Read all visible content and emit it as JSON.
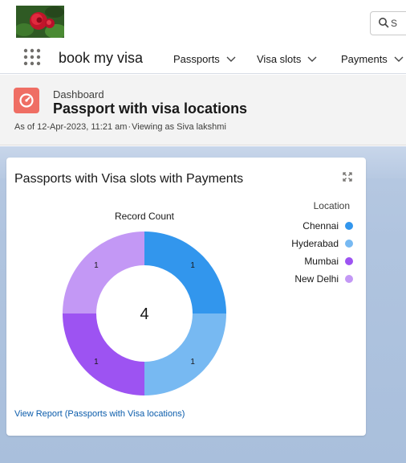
{
  "search": {
    "text": "S"
  },
  "nav": {
    "app_name": "book my visa",
    "items": [
      {
        "label": "Passports"
      },
      {
        "label": "Visa slots"
      },
      {
        "label": "Payments"
      }
    ]
  },
  "header": {
    "kicker": "Dashboard",
    "title": "Passport with visa locations",
    "as_of": "As of 12-Apr-2023, 11:21 am",
    "separator": "·",
    "viewing": "Viewing as Siva lakshmi"
  },
  "card": {
    "title": "Passports with Visa slots with Payments",
    "view_report": "View Report (Passports with Visa locations)"
  },
  "colors": {
    "brand_icon": "#ef6e64",
    "link": "#0b5cab"
  },
  "chart_data": {
    "type": "donut",
    "title": "Record Count",
    "center_label": "4",
    "legend_title": "Location",
    "legend_position": "right",
    "categories": [
      "Chennai",
      "Hyderabad",
      "Mumbai",
      "New Delhi"
    ],
    "values": [
      1,
      1,
      1,
      1
    ],
    "colors": [
      "#3296ed",
      "#77b9f2",
      "#9d53f2",
      "#c398f5"
    ],
    "data_labels": [
      "1",
      "1",
      "1",
      "1"
    ]
  }
}
